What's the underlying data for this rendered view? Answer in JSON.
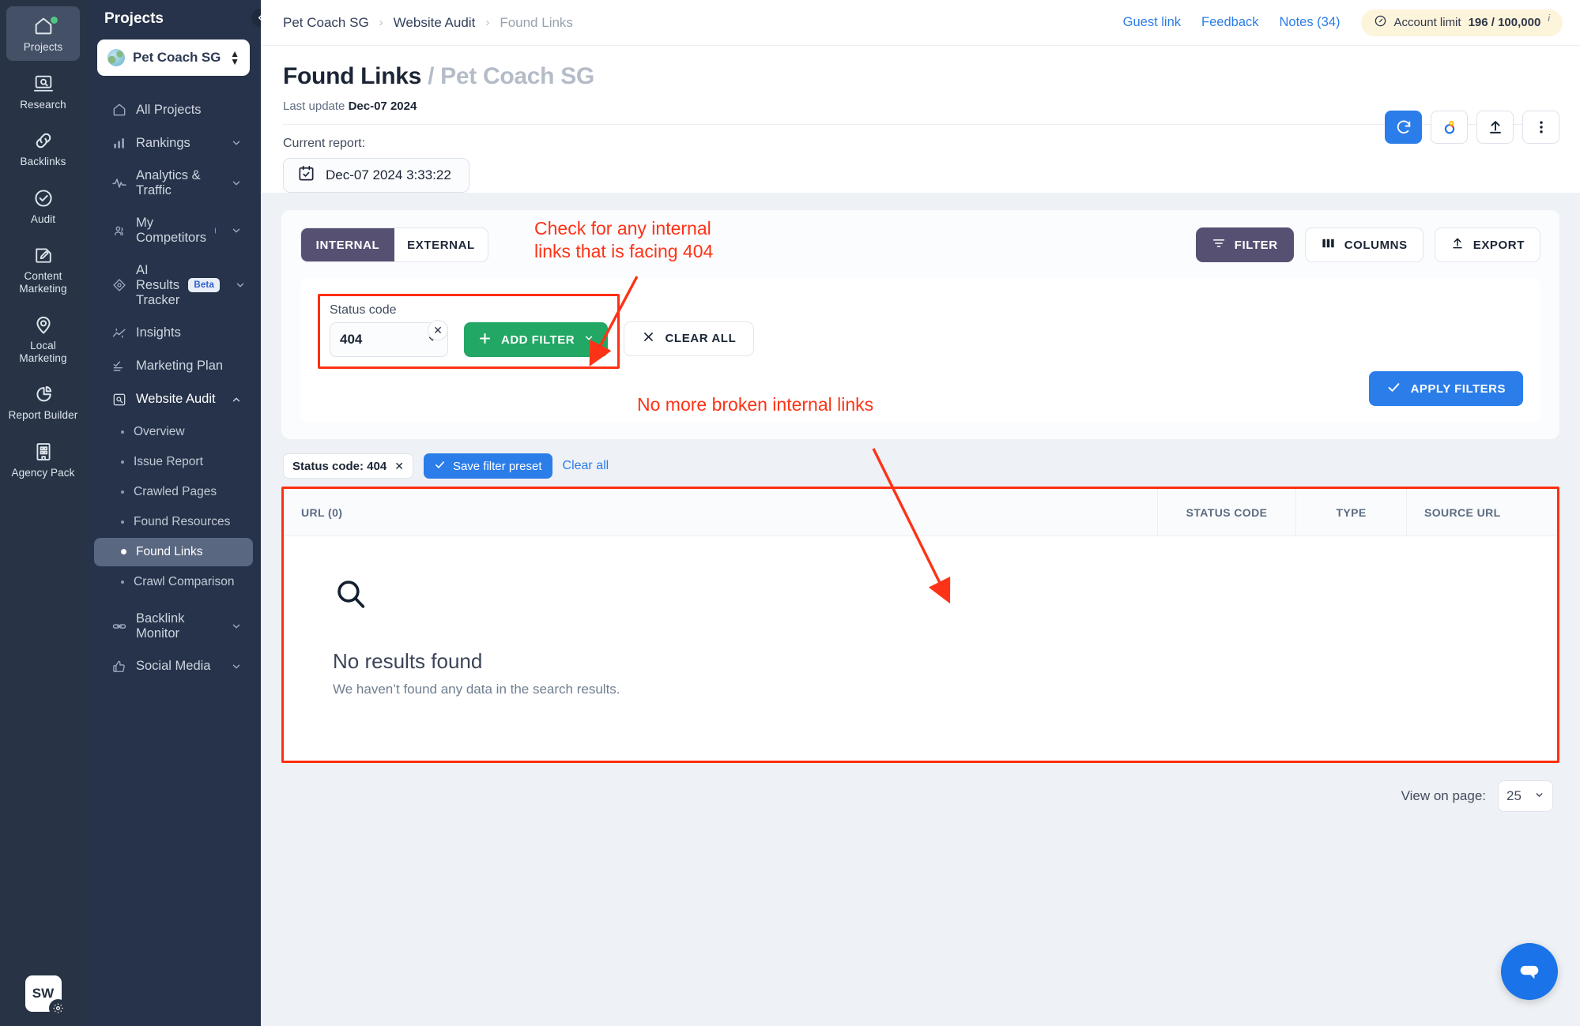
{
  "rail": {
    "items": [
      {
        "label": "Projects",
        "icon": "home-icon",
        "active": true,
        "dot": true
      },
      {
        "label": "Research",
        "icon": "research-icon",
        "active": false,
        "dot": false
      },
      {
        "label": "Backlinks",
        "icon": "link-icon",
        "active": false,
        "dot": false
      },
      {
        "label": "Audit",
        "icon": "check-circle-icon",
        "active": false,
        "dot": false
      },
      {
        "label": "Content\nMarketing",
        "icon": "pencil-square-icon",
        "active": false,
        "dot": false
      },
      {
        "label": "Local\nMarketing",
        "icon": "map-pin-icon",
        "active": false,
        "dot": false
      },
      {
        "label": "Report\nBuilder",
        "icon": "pie-chart-icon",
        "active": false,
        "dot": false
      },
      {
        "label": "Agency\nPack",
        "icon": "building-icon",
        "active": false,
        "dot": false
      }
    ],
    "avatar_initials": "SW"
  },
  "sidebar": {
    "title": "Projects",
    "project": "Pet Coach SG",
    "items": [
      {
        "label": "All Projects",
        "icon": "home-outline-icon",
        "chevron": false,
        "dot": false,
        "badge": null
      },
      {
        "label": "Rankings",
        "icon": "bar-chart-icon",
        "chevron": "down",
        "dot": false,
        "badge": null
      },
      {
        "label": "Analytics & Traffic",
        "icon": "pulse-icon",
        "chevron": "down",
        "dot": false,
        "badge": null
      },
      {
        "label": "My Competitors",
        "icon": "people-icon",
        "chevron": "down",
        "dot": true,
        "badge": null
      },
      {
        "label": "AI Results Tracker",
        "icon": "ai-node-icon",
        "chevron": "down",
        "dot": false,
        "badge": "Beta"
      },
      {
        "label": "Insights",
        "icon": "trend-icon",
        "chevron": false,
        "dot": false,
        "badge": null
      },
      {
        "label": "Marketing Plan",
        "icon": "checklist-icon",
        "chevron": false,
        "dot": false,
        "badge": null
      },
      {
        "label": "Website Audit",
        "icon": "audit-icon",
        "chevron": "up",
        "dot": false,
        "badge": null
      }
    ],
    "sub_items": [
      {
        "label": "Overview",
        "active": false
      },
      {
        "label": "Issue Report",
        "active": false
      },
      {
        "label": "Crawled Pages",
        "active": false
      },
      {
        "label": "Found Resources",
        "active": false
      },
      {
        "label": "Found Links",
        "active": true
      },
      {
        "label": "Crawl Comparison",
        "active": false
      }
    ],
    "items_after": [
      {
        "label": "Backlink Monitor",
        "icon": "chain-icon",
        "chevron": "down"
      },
      {
        "label": "Social Media",
        "icon": "thumbs-up-icon",
        "chevron": "down"
      }
    ]
  },
  "topbar": {
    "breadcrumb": [
      "Pet Coach SG",
      "Website Audit",
      "Found Links"
    ],
    "links": [
      "Guest link",
      "Feedback",
      "Notes (34)"
    ],
    "account_limit_label": "Account limit",
    "account_limit_value": "196 / 100,000",
    "account_limit_sup": "i"
  },
  "page": {
    "title": "Found Links",
    "title_sep": "/",
    "title_project": "Pet Coach SG",
    "last_update_label": "Last update",
    "last_update_value": "Dec-07 2024",
    "current_report_label": "Current report:",
    "current_report_value": "Dec-07 2024 3:33:22"
  },
  "head_actions": [
    {
      "name": "refresh-button",
      "icon": "refresh-icon"
    },
    {
      "name": "google-search-console-button",
      "icon": "gsc-icon"
    },
    {
      "name": "upload-button",
      "icon": "upload-icon"
    },
    {
      "name": "more-options-button",
      "icon": "kebab-icon"
    }
  ],
  "toolbar": {
    "segments": [
      {
        "label": "INTERNAL",
        "active": true
      },
      {
        "label": "EXTERNAL",
        "active": false
      }
    ],
    "filter_label": "FILTER",
    "columns_label": "COLUMNS",
    "export_label": "EXPORT"
  },
  "filters": {
    "status_code_label": "Status code",
    "status_code_value": "404",
    "add_filter_label": "ADD FILTER",
    "clear_all_label": "CLEAR ALL",
    "apply_label": "APPLY FILTERS",
    "chip_label": "Status code: 404",
    "save_preset_label": "Save filter preset",
    "clear_all_link": "Clear all"
  },
  "table": {
    "columns": [
      "URL  (0)",
      "STATUS CODE",
      "TYPE",
      "SOURCE URL"
    ],
    "rows": [],
    "empty_title": "No results found",
    "empty_subtitle": "We haven’t found any data in the search results."
  },
  "pager": {
    "label": "View on page:",
    "value": "25"
  },
  "annotations": [
    {
      "text": "Check for any internal\nlinks that is facing 404"
    },
    {
      "text": "No more broken internal links"
    }
  ],
  "colors": {
    "accent_blue": "#2b7de9",
    "purple": "#565173",
    "green": "#22a765",
    "annotation_red": "#fd3317",
    "sidebar_dark": "#26334a",
    "rail_dark": "#283446"
  }
}
